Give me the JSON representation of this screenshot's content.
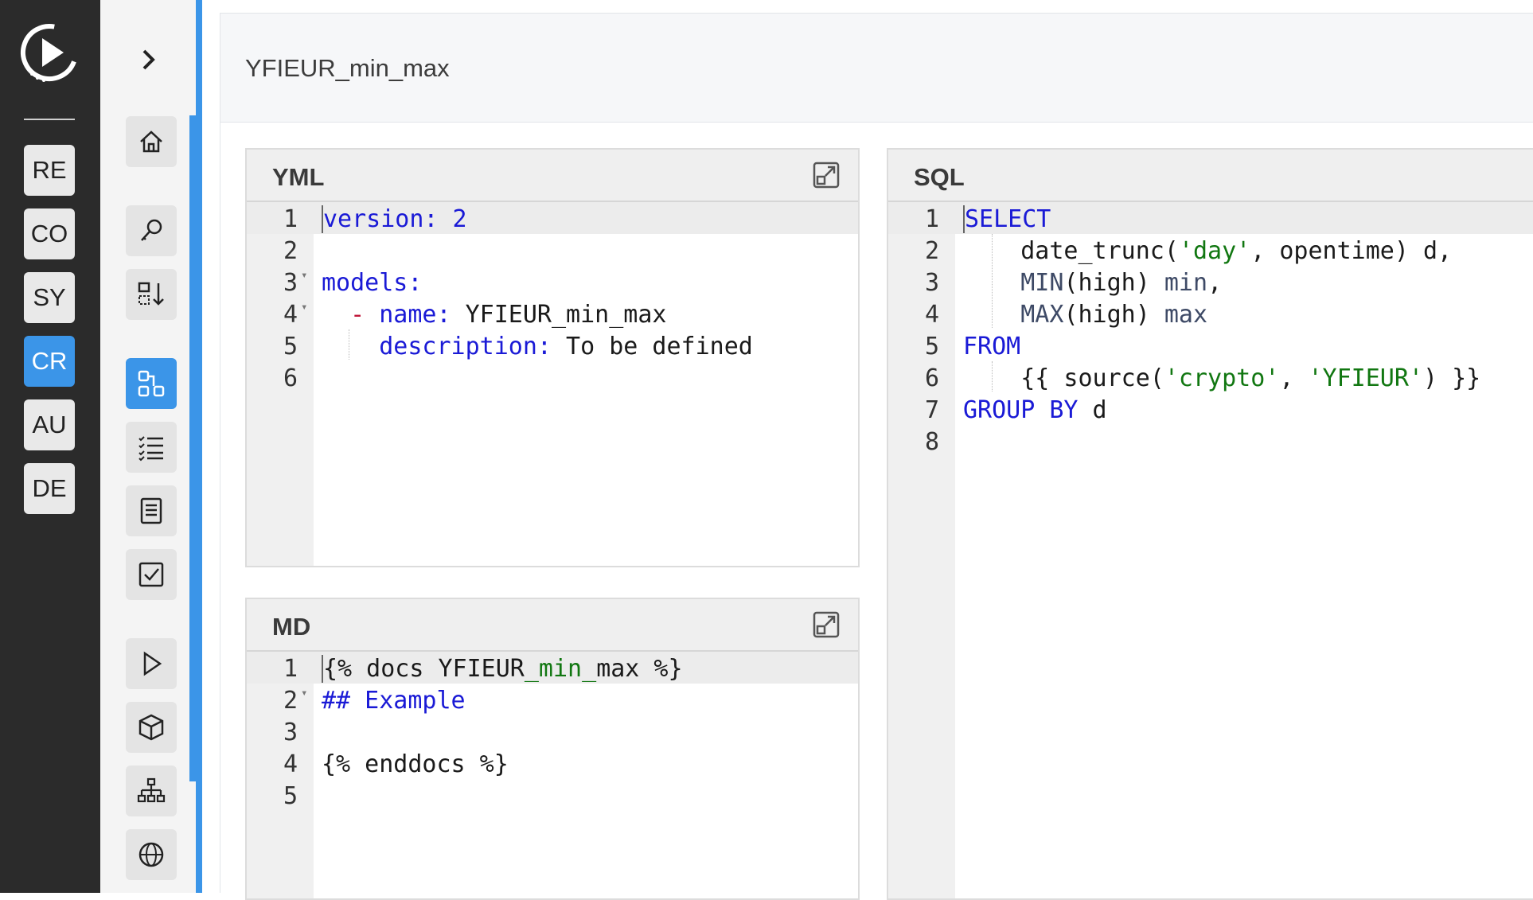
{
  "rail": {
    "projects": [
      {
        "label": "RE",
        "active": false
      },
      {
        "label": "CO",
        "active": false
      },
      {
        "label": "SY",
        "active": false
      },
      {
        "label": "CR",
        "active": true
      },
      {
        "label": "AU",
        "active": false
      },
      {
        "label": "DE",
        "active": false
      }
    ]
  },
  "tools": [
    "home-icon",
    "search-icon",
    "sort-download-icon",
    "model-graph-icon",
    "checklist-icon",
    "document-icon",
    "checkbox-icon",
    "play-icon",
    "cube-icon",
    "hierarchy-icon",
    "globe-icon"
  ],
  "header": {
    "title": "YFIEUR_min_max"
  },
  "panels": {
    "yml": {
      "title": "YML",
      "line_numbers": [
        "1",
        "2",
        "3",
        "4",
        "5",
        "6"
      ],
      "lines": [
        {
          "key": "version:",
          "value": " 2"
        },
        {
          "text": ""
        },
        {
          "key": "models:"
        },
        {
          "dash": "- ",
          "key": "name:",
          "value": " YFIEUR_min_max"
        },
        {
          "key": "description:",
          "value": " To be defined"
        },
        {
          "text": ""
        }
      ]
    },
    "md": {
      "title": "MD",
      "line_numbers": [
        "1",
        "2",
        "3",
        "4",
        "5"
      ],
      "lines": [
        {
          "a": "{% docs YFIEUR",
          "b": "_min_",
          "c": "max %}"
        },
        {
          "heading": "## Example"
        },
        {
          "text": ""
        },
        {
          "text": "{% enddocs %}"
        },
        {
          "text": ""
        }
      ]
    },
    "sql": {
      "title": "SQL",
      "line_numbers": [
        "1",
        "2",
        "3",
        "4",
        "5",
        "6",
        "7",
        "8"
      ],
      "lines": [
        {
          "kw": "SELECT"
        },
        {
          "a": "date_trunc(",
          "s": "'day'",
          "b": ", opentime) d,"
        },
        {
          "fn": "MIN",
          "a": "(high) ",
          "fn2": "min",
          "b": ","
        },
        {
          "fn": "MAX",
          "a": "(high) ",
          "fn2": "max"
        },
        {
          "kw": "FROM"
        },
        {
          "a": "{{ source(",
          "s": "'crypto'",
          "b": ", ",
          "s2": "'YFIEUR'",
          "c": ") }}"
        },
        {
          "kw": "GROUP BY",
          "a": " d"
        },
        {
          "text": ""
        }
      ]
    }
  },
  "colors": {
    "accent": "#3b95e8",
    "keyword": "#1a1ad6",
    "string": "#117711",
    "rail": "#2b2b2b"
  }
}
